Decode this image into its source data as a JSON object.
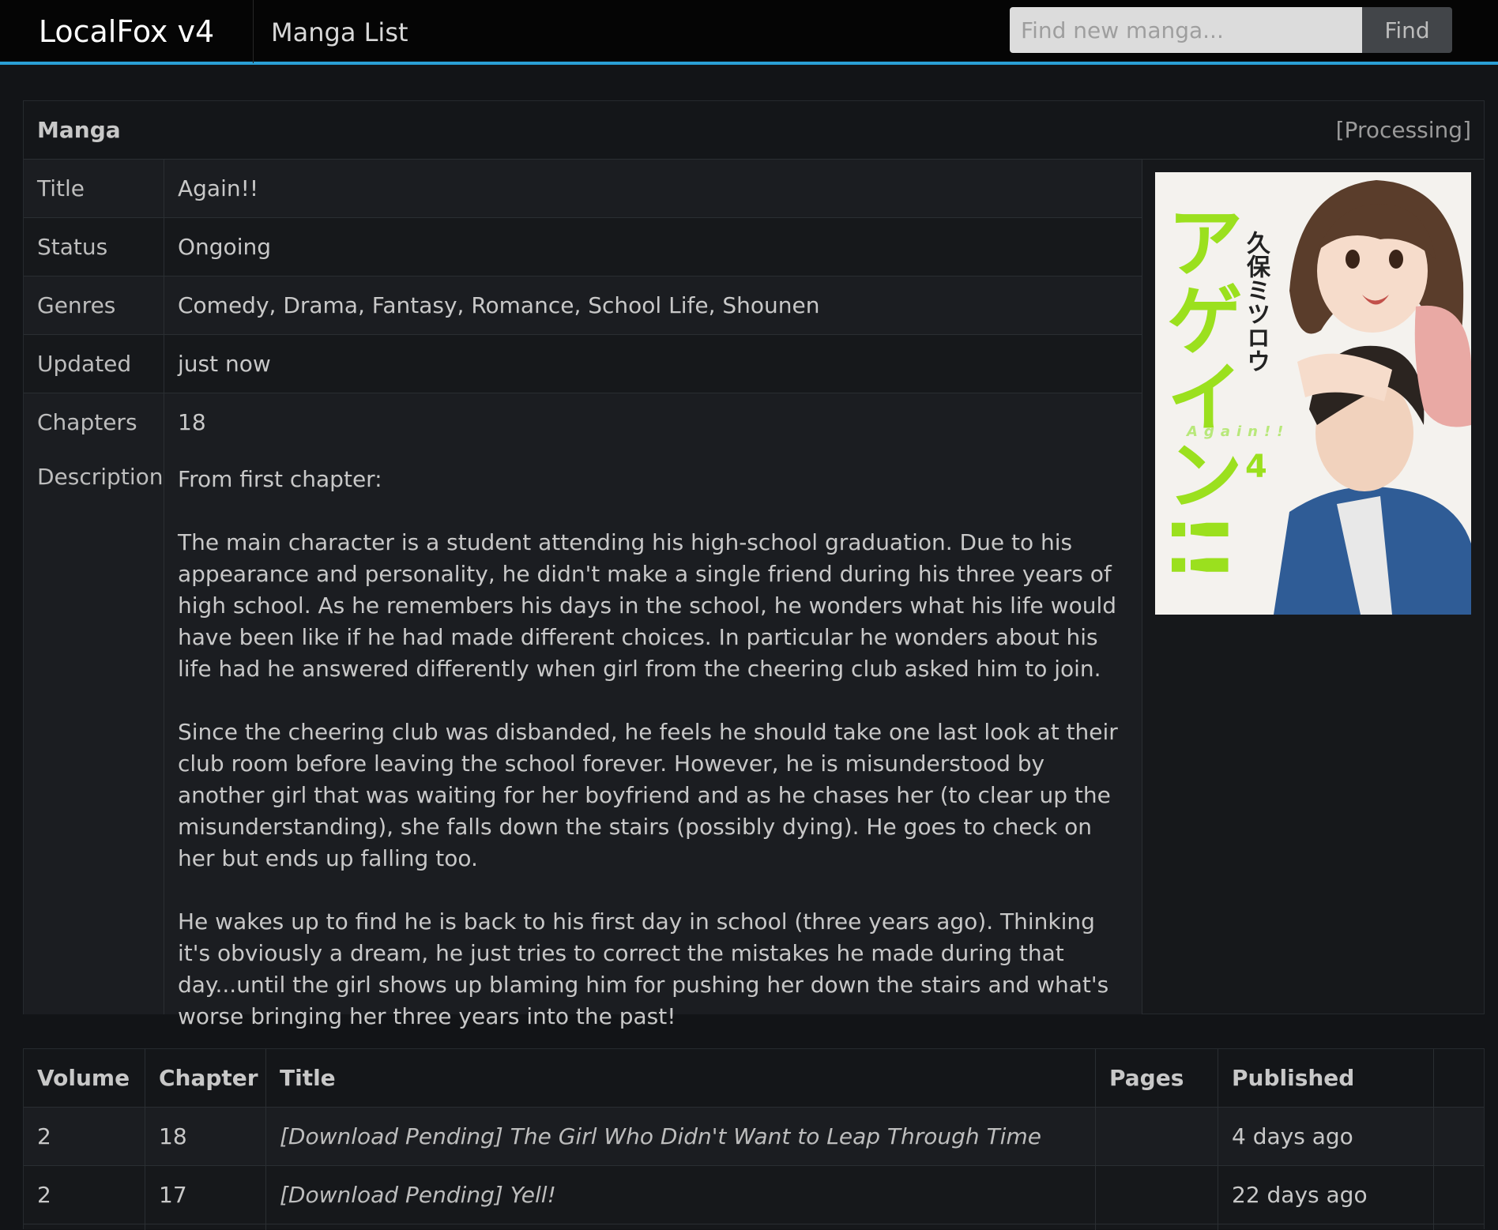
{
  "navbar": {
    "brand": "LocalFox v4",
    "link_manga_list": "Manga List",
    "search_placeholder": "Find new manga...",
    "search_button": "Find"
  },
  "manga": {
    "header": "Manga",
    "status_tag": "[Processing]",
    "labels": {
      "title": "Title",
      "status": "Status",
      "genres": "Genres",
      "updated": "Updated",
      "chapters": "Chapters",
      "description": "Description"
    },
    "title": "Again!!",
    "status": "Ongoing",
    "genres": "Comedy, Drama, Fantasy, Romance, School Life, Shounen",
    "updated": "just now",
    "chapters": "18",
    "description": [
      "From first chapter:",
      "The main character is a student attending his high-school graduation. Due to his appearance and personality, he didn't make a single friend during his three years of high school. As he remembers his days in the school, he wonders what his life would have been like if he had made different choices. In particular he wonders about his life had he answered differently when girl from the cheering club asked him to join.",
      "Since the cheering club was disbanded, he feels he should take one last look at their club room before leaving the school forever. However, he is misunderstood by another girl that was waiting for her boyfriend and as he chases her (to clear up the misunderstanding), she falls down the stairs (possibly dying). He goes to check on her but ends up falling too.",
      "He wakes up to find he is back to his first day in school (three years ago). Thinking it's obviously a dream, he just tries to correct the mistakes he made during that day...until the girl shows up blaming him for pushing her down the stairs and what's worse bringing her three years into the past!"
    ],
    "cover": {
      "title_kana": "アゲイン!!",
      "author_kana": "久保ミツロウ",
      "volume": "4",
      "subtitle": "Again!!",
      "accent_color": "#9be01e"
    }
  },
  "chapter_table": {
    "headers": [
      "Volume",
      "Chapter",
      "Title",
      "Pages",
      "Published"
    ],
    "rows": [
      {
        "volume": "2",
        "chapter": "18",
        "title": "[Download Pending] The Girl Who Didn't Want to Leap Through Time",
        "pages": "",
        "published": "4 days ago"
      },
      {
        "volume": "2",
        "chapter": "17",
        "title": "[Download Pending] Yell!",
        "pages": "",
        "published": "22 days ago"
      }
    ]
  }
}
